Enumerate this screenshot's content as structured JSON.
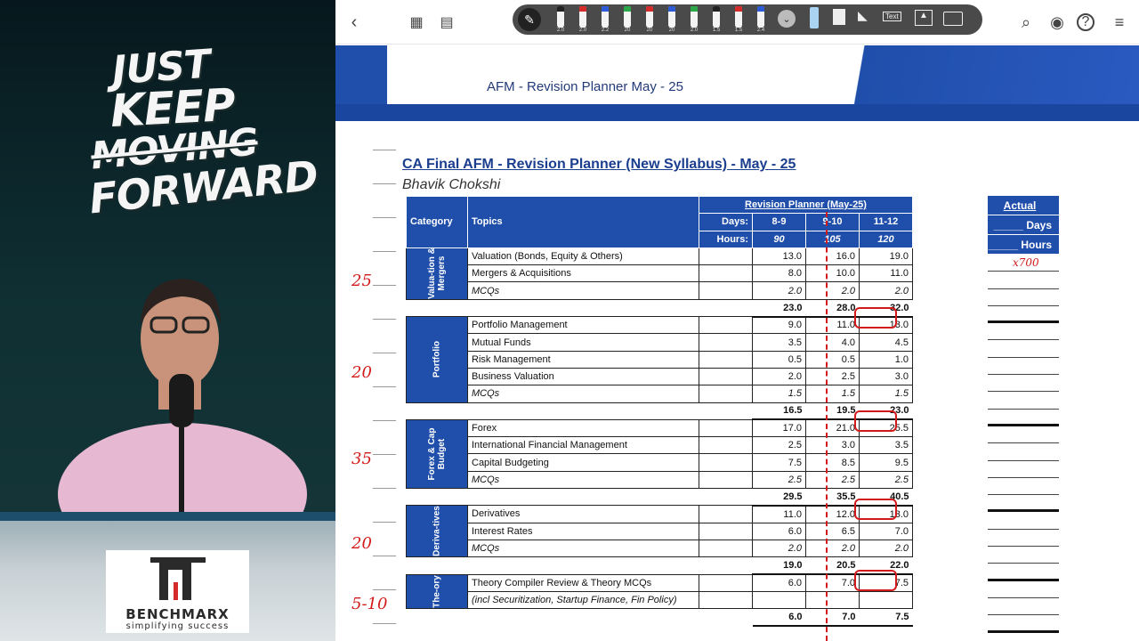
{
  "motto": {
    "line1": "JUST",
    "line2": "KEEP",
    "line3": "MOVING",
    "line4": "FORWARD"
  },
  "brand": {
    "name": "BENCHMARX",
    "tagline": "simplifying success"
  },
  "toolbar": {
    "pens": [
      {
        "color": "#222222",
        "size": "2.0"
      },
      {
        "color": "#d62b2b",
        "size": "2.0"
      },
      {
        "color": "#2d5bd6",
        "size": "2.2"
      },
      {
        "color": "#2aa84a",
        "size": "20"
      },
      {
        "color": "#d62b2b",
        "size": "20"
      },
      {
        "color": "#2d5bd6",
        "size": "20"
      },
      {
        "color": "#2aa84a",
        "size": "2.0"
      },
      {
        "color": "#222222",
        "size": "1.5"
      },
      {
        "color": "#d62b2b",
        "size": "1.5"
      },
      {
        "color": "#2d5bd6",
        "size": "2.4"
      }
    ],
    "text_tool_label": "Text"
  },
  "doc": {
    "header_title": "AFM - Revision Planner May - 25",
    "title": "CA Final AFM - Revision Planner (New Syllabus) - May - 25",
    "author": "Bhavik Chokshi",
    "headers": {
      "category": "Category",
      "topics": "Topics",
      "planner": "Revision Planner (May-25)",
      "days_label": "Days:",
      "hours_label": "Hours:",
      "days": [
        "8-9",
        "9-10",
        "11-12"
      ],
      "hours": [
        "90",
        "105",
        "120"
      ],
      "actual": "Actual",
      "actual_days": "_____ Days",
      "actual_hours": "_____ Hours"
    },
    "groups": [
      {
        "category": "Valua-tion & Mergers",
        "rows": [
          {
            "topic": "Valuation (Bonds, Equity & Others)",
            "v": [
              "13.0",
              "16.0",
              "19.0"
            ],
            "italic": false
          },
          {
            "topic": "Mergers & Acquisitions",
            "v": [
              "8.0",
              "10.0",
              "11.0"
            ],
            "italic": false
          },
          {
            "topic": "MCQs",
            "v": [
              "2.0",
              "2.0",
              "2.0"
            ],
            "italic": true
          }
        ],
        "total": [
          "23.0",
          "28.0",
          "32.0"
        ]
      },
      {
        "category": "Portfolio",
        "rows": [
          {
            "topic": "Portfolio Management",
            "v": [
              "9.0",
              "11.0",
              "13.0"
            ],
            "italic": false
          },
          {
            "topic": "Mutual Funds",
            "v": [
              "3.5",
              "4.0",
              "4.5"
            ],
            "italic": false
          },
          {
            "topic": "Risk Management",
            "v": [
              "0.5",
              "0.5",
              "1.0"
            ],
            "italic": false
          },
          {
            "topic": "Business Valuation",
            "v": [
              "2.0",
              "2.5",
              "3.0"
            ],
            "italic": false
          },
          {
            "topic": "MCQs",
            "v": [
              "1.5",
              "1.5",
              "1.5"
            ],
            "italic": true
          }
        ],
        "total": [
          "16.5",
          "19.5",
          "23.0"
        ]
      },
      {
        "category": "Forex & Cap Budget",
        "rows": [
          {
            "topic": "Forex",
            "v": [
              "17.0",
              "21.0",
              "25.5"
            ],
            "italic": false
          },
          {
            "topic": "International Financial Management",
            "v": [
              "2.5",
              "3.0",
              "3.5"
            ],
            "italic": false
          },
          {
            "topic": "Capital Budgeting",
            "v": [
              "7.5",
              "8.5",
              "9.5"
            ],
            "italic": false
          },
          {
            "topic": "MCQs",
            "v": [
              "2.5",
              "2.5",
              "2.5"
            ],
            "italic": true
          }
        ],
        "total": [
          "29.5",
          "35.5",
          "40.5"
        ]
      },
      {
        "category": "Deriva-tives",
        "rows": [
          {
            "topic": "Derivatives",
            "v": [
              "11.0",
              "12.0",
              "13.0"
            ],
            "italic": false
          },
          {
            "topic": "Interest Rates",
            "v": [
              "6.0",
              "6.5",
              "7.0"
            ],
            "italic": false
          },
          {
            "topic": "MCQs",
            "v": [
              "2.0",
              "2.0",
              "2.0"
            ],
            "italic": true
          }
        ],
        "total": [
          "19.0",
          "20.5",
          "22.0"
        ]
      },
      {
        "category": "The-ory",
        "rows": [
          {
            "topic": "Theory Compiler Review & Theory MCQs",
            "v": [
              "6.0",
              "7.0",
              "7.5"
            ],
            "italic": false
          },
          {
            "topic": "(incl Securitization, Startup Finance, Fin Policy)",
            "v": [
              "",
              "",
              ""
            ],
            "italic": true
          }
        ],
        "total": [
          "6.0",
          "7.0",
          "7.5"
        ]
      }
    ],
    "annotations": [
      "25",
      "20",
      "35",
      "20",
      "5-10"
    ],
    "actual_note": "x700"
  }
}
